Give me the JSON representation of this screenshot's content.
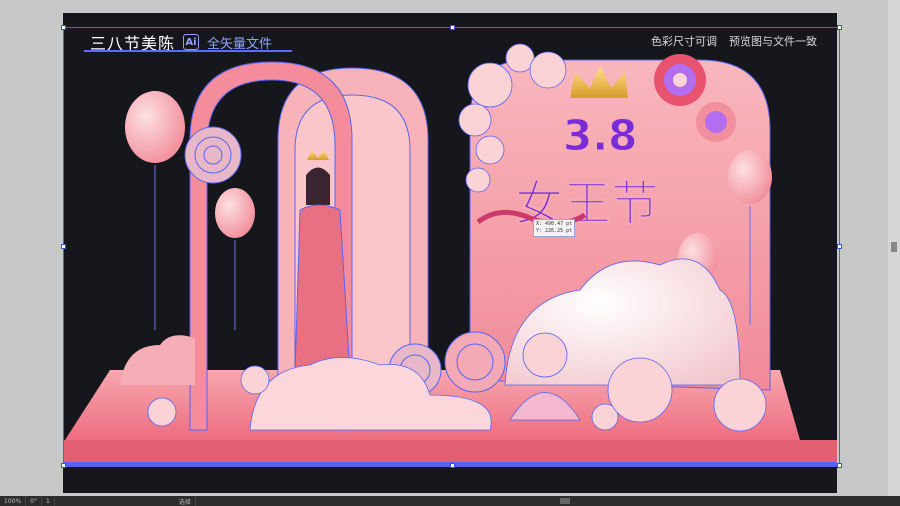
{
  "header": {
    "title": "三八节美陈",
    "ai_badge": "Ai",
    "subtitle": "全矢量文件",
    "notes": [
      "色彩尺寸可调",
      "预览图与文件一致"
    ]
  },
  "artwork": {
    "main_text": "3.8",
    "sub_text": "女王节"
  },
  "readout": {
    "x": "X: 490.47 pt",
    "y": "Y: 226.25 pt"
  },
  "statusbar": {
    "zoom": "100%",
    "rotation": "0°",
    "page": "1",
    "tool": "选择"
  },
  "colors": {
    "background": "#15171d",
    "pink": "#f59aa5",
    "pink_light": "#fcc9cd",
    "pink_dark": "#e96f82",
    "path_blue": "#5865f2",
    "title_blue": "#8fa2ff"
  }
}
